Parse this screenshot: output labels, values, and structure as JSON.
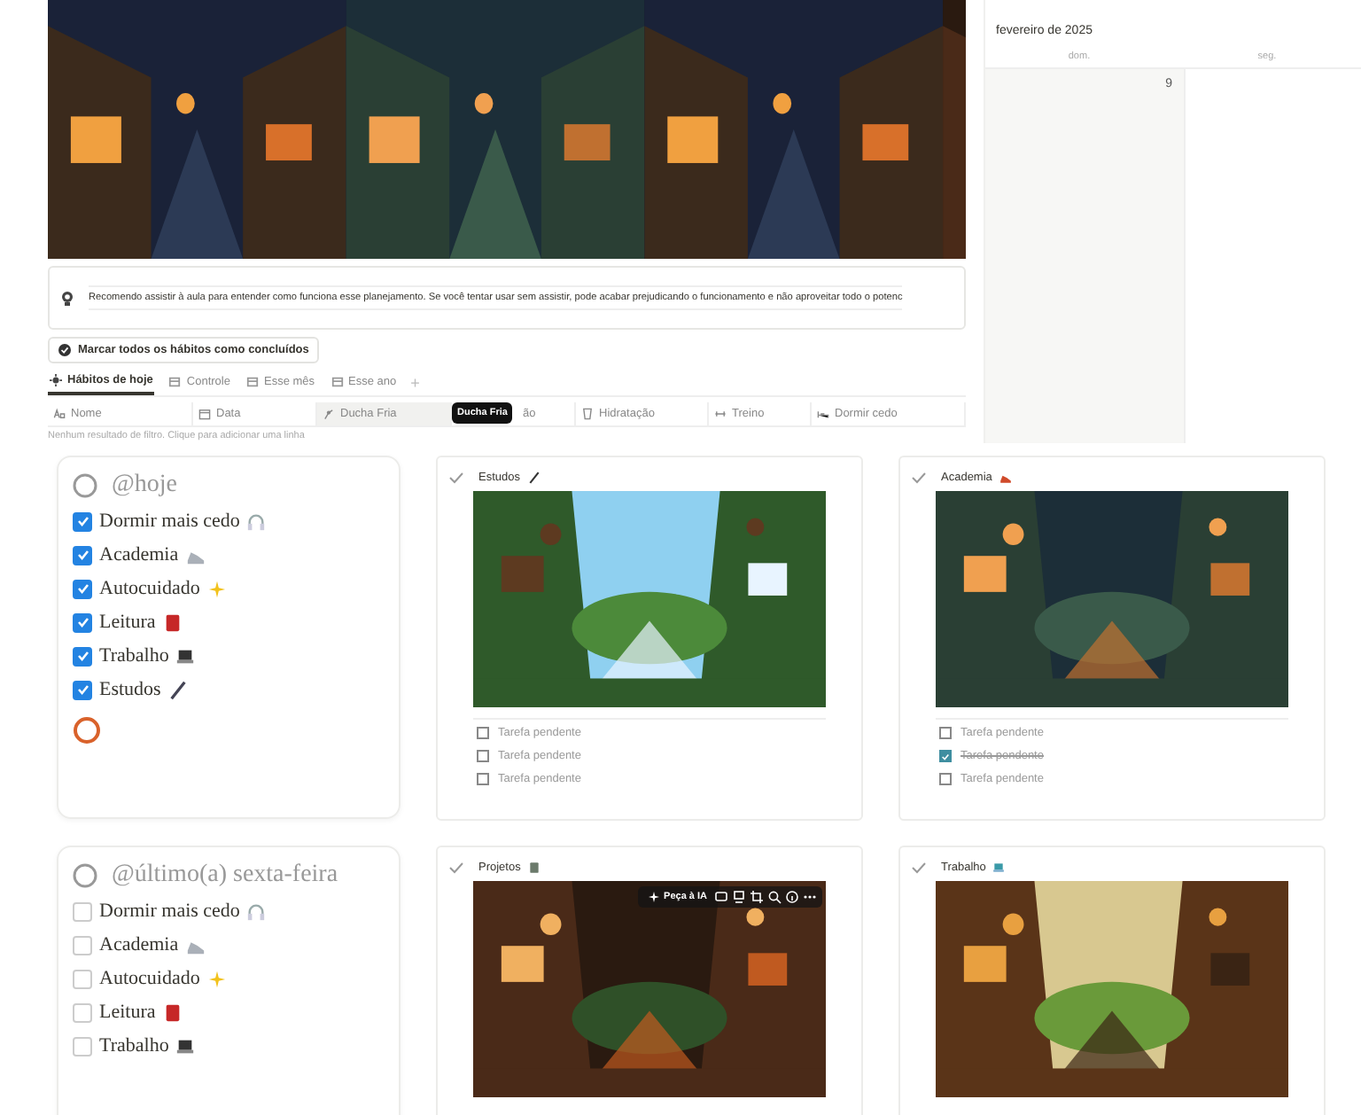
{
  "callout": {
    "text": "Recomendo assistir à aula para entender como funciona esse planejamento. Se você tentar usar sem assistir, pode acabar prejudicando o funcionamento e não aproveitar todo o potenc"
  },
  "mark_all_button": {
    "label": "Marcar todos os hábitos como concluídos"
  },
  "tabs": [
    {
      "label": "Hábitos de hoje",
      "selected": true
    },
    {
      "label": "Controle",
      "selected": false
    },
    {
      "label": "Esse mês",
      "selected": false
    },
    {
      "label": "Esse ano",
      "selected": false
    }
  ],
  "add_tab": "+",
  "table": {
    "columns": [
      {
        "label": "Nome",
        "hovered": false
      },
      {
        "label": "Data",
        "hovered": false
      },
      {
        "label": "Ducha Fria",
        "hovered": true
      },
      {
        "label": "ão",
        "hovered": false
      },
      {
        "label": "Hidratação",
        "hovered": false
      },
      {
        "label": "Treino",
        "hovered": false
      },
      {
        "label": "Dormir cedo",
        "hovered": false
      }
    ],
    "tooltip": "Ducha Fria",
    "empty_message": "Nenhum resultado de filtro. Clique para adicionar uma linha"
  },
  "calendar": {
    "month": "fevereiro de 2025",
    "weekdays": [
      "dom.",
      "seg."
    ],
    "days": [
      "9"
    ]
  },
  "habit_cards": [
    {
      "title": "@hoje",
      "progress_ring": true,
      "items": [
        {
          "label": "Dormir mais cedo",
          "checked": true
        },
        {
          "label": "Academia",
          "checked": true
        },
        {
          "label": "Autocuidado",
          "checked": true
        },
        {
          "label": "Leitura",
          "checked": true
        },
        {
          "label": "Trabalho",
          "checked": true
        },
        {
          "label": "Estudos",
          "checked": true
        }
      ]
    },
    {
      "title": "@último(a) sexta-feira",
      "progress_ring": false,
      "items": [
        {
          "label": "Dormir mais cedo",
          "checked": false
        },
        {
          "label": "Academia",
          "checked": false
        },
        {
          "label": "Autocuidado",
          "checked": false
        },
        {
          "label": "Leitura",
          "checked": false
        },
        {
          "label": "Trabalho",
          "checked": false
        }
      ]
    }
  ],
  "gallery": [
    {
      "title": "Estudos",
      "tasks": [
        {
          "label": "Tarefa pendente",
          "checked": false
        },
        {
          "label": "Tarefa pendente",
          "checked": false
        },
        {
          "label": "Tarefa pendente",
          "checked": false
        }
      ]
    },
    {
      "title": "Academia",
      "tasks": [
        {
          "label": "Tarefa pendente",
          "checked": false
        },
        {
          "label": "Tarefa pendente",
          "checked": true
        },
        {
          "label": "Tarefa pendente",
          "checked": false
        }
      ]
    },
    {
      "title": "Projetos",
      "toolbar": {
        "ask_ai": "Peça à IA"
      }
    },
    {
      "title": "Trabalho"
    }
  ]
}
